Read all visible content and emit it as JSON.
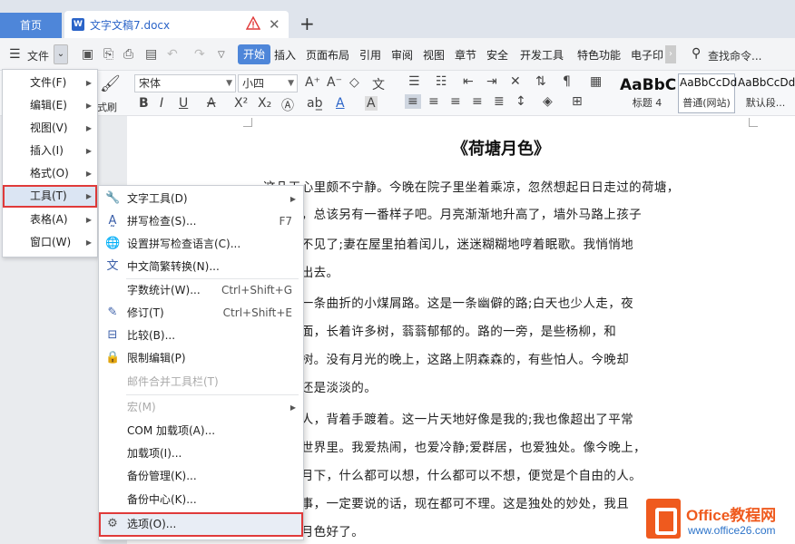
{
  "tabs": {
    "home": "首页",
    "doc_title": "文字文稿7.docx"
  },
  "menubar": {
    "file": "文件",
    "tabs": [
      "开始",
      "插入",
      "页面布局",
      "引用",
      "审阅",
      "视图",
      "章节",
      "安全",
      "开发工具",
      "特色功能",
      "电子印"
    ],
    "search": "查找命令..."
  },
  "ribbon": {
    "font_name": "宋体",
    "font_size": "小四",
    "pair_label": "式刷",
    "styles": [
      {
        "sample": "AaBbC",
        "name": "标题 4"
      },
      {
        "sample": "AaBbCcDd",
        "name": "普通(网站)"
      },
      {
        "sample": "AaBbCcDd",
        "name": "默认段..."
      }
    ]
  },
  "file_menu": {
    "items": [
      {
        "label": "文件(F)"
      },
      {
        "label": "编辑(E)"
      },
      {
        "label": "视图(V)"
      },
      {
        "label": "插入(I)"
      },
      {
        "label": "格式(O)"
      },
      {
        "label": "工具(T)"
      },
      {
        "label": "表格(A)"
      },
      {
        "label": "窗口(W)"
      }
    ]
  },
  "tools_menu": {
    "items": [
      {
        "label": "文字工具(D)",
        "shortcut": ""
      },
      {
        "label": "拼写检查(S)...",
        "shortcut": "F7"
      },
      {
        "label": "设置拼写检查语言(C)...",
        "shortcut": ""
      },
      {
        "label": "中文简繁转换(N)...",
        "shortcut": ""
      },
      {
        "label": "字数统计(W)...",
        "shortcut": "Ctrl+Shift+G"
      },
      {
        "label": "修订(T)",
        "shortcut": "Ctrl+Shift+E"
      },
      {
        "label": "比较(B)...",
        "shortcut": ""
      },
      {
        "label": "限制编辑(P)",
        "shortcut": ""
      },
      {
        "label": "邮件合并工具栏(T)",
        "shortcut": ""
      },
      {
        "label": "宏(M)",
        "shortcut": ""
      },
      {
        "label": "COM 加载项(A)...",
        "shortcut": ""
      },
      {
        "label": "加载项(I)...",
        "shortcut": ""
      },
      {
        "label": "备份管理(K)...",
        "shortcut": ""
      },
      {
        "label": "备份中心(K)...",
        "shortcut": ""
      },
      {
        "label": "选项(O)...",
        "shortcut": ""
      }
    ]
  },
  "document": {
    "heading": "《荷塘月色》",
    "lines": [
      "这几天心里颇不宁静。今晚在院子里坐着乘凉，忽然想起日日走过的荷塘，",
      "   月光里，总该另有一番样子吧。月亮渐渐地升高了，墙外马路上孩子",
      "   已经听不见了;妻在屋里拍着闰儿，迷迷糊糊地哼着眠歌。我悄悄地",
      "   带上门出去。",
      "   塘，是一条曲折的小煤屑路。这是一条幽僻的路;白天也少人走，夜",
      "   荷塘四面，长着许多树，蓊蓊郁郁的。路的一旁，是些杨柳，和",
      "   名字的树。没有月光的晚上，这路上阴森森的，有些怕人。今晚却",
      "   月光也还是淡淡的。",
      "   我一个人，背着手踱着。这一片天地好像是我的;我也像超出了平常",
      "   了另一世界里。我爱热闹，也爱冷静;爱群居，也爱独处。像今晚上，",
      "   苍茫的月下，什么都可以想，什么都可以不想，便觉是个自由的人。",
      "   要做的事，一定要说的话，现在都可不理。这是独处的妙处，我且",
      "   的荷香月色好了。"
    ]
  },
  "watermark": {
    "brand": "Office教程网",
    "url": "www.office26.com"
  }
}
